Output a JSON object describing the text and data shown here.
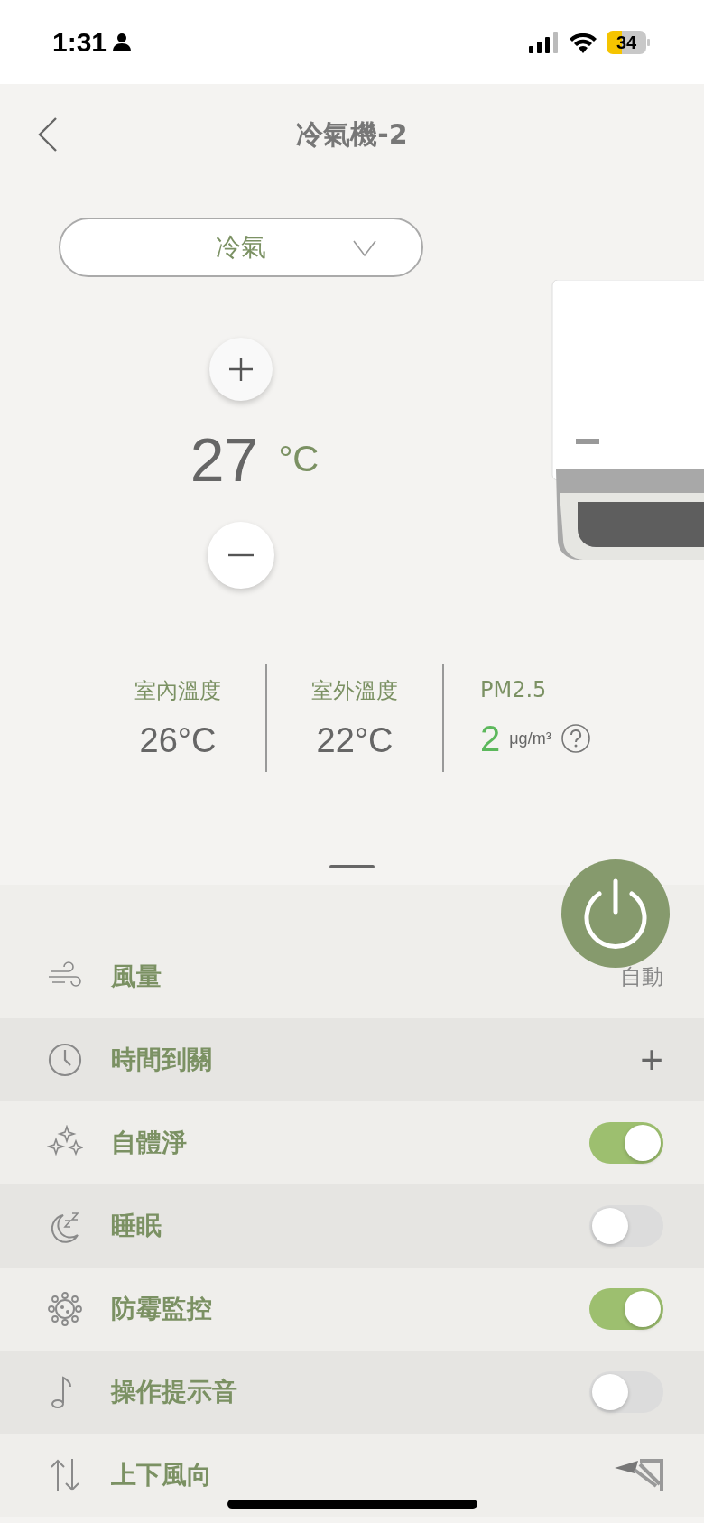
{
  "status_bar": {
    "time": "1:31",
    "battery": "34"
  },
  "header": {
    "title": "冷氣機-2"
  },
  "mode_dropdown": {
    "value": "冷氣"
  },
  "temperature": {
    "value": "27",
    "unit": "°C"
  },
  "stats": [
    {
      "label": "室內溫度",
      "value": "26°C",
      "kind": "temp"
    },
    {
      "label": "室外溫度",
      "value": "22°C",
      "kind": "temp"
    },
    {
      "label": "PM2.5",
      "value": "2",
      "unit": "μg/m³",
      "kind": "pm"
    }
  ],
  "settings": [
    {
      "label": "風量",
      "kind": "value",
      "value": "自動"
    },
    {
      "label": "時間到關",
      "kind": "add",
      "action": "+"
    },
    {
      "label": "自體淨",
      "kind": "toggle",
      "on": true
    },
    {
      "label": "睡眠",
      "kind": "toggle",
      "on": false
    },
    {
      "label": "防霉監控",
      "kind": "toggle",
      "on": true
    },
    {
      "label": "操作提示音",
      "kind": "toggle",
      "on": false
    },
    {
      "label": "上下風向",
      "kind": "direction"
    }
  ]
}
